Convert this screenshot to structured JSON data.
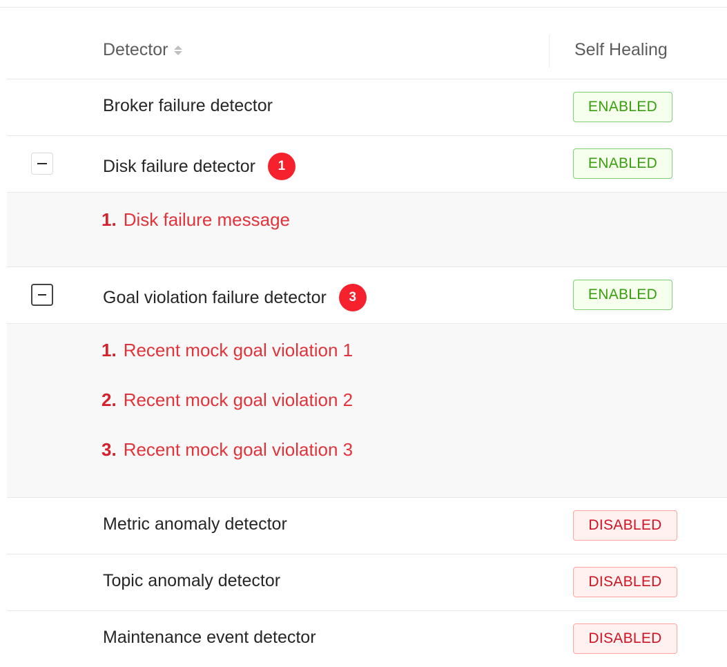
{
  "table": {
    "columns": {
      "detector": "Detector",
      "self_healing": "Self Healing"
    },
    "rows": [
      {
        "name": "Broker failure detector",
        "status": "ENABLED"
      },
      {
        "name": "Disk failure detector",
        "count": "1",
        "status": "ENABLED",
        "messages": [
          {
            "num": "1.",
            "text": "Disk failure message"
          }
        ]
      },
      {
        "name": "Goal violation failure detector",
        "count": "3",
        "status": "ENABLED",
        "messages": [
          {
            "num": "1.",
            "text": "Recent mock goal violation 1"
          },
          {
            "num": "2.",
            "text": "Recent mock goal violation 2"
          },
          {
            "num": "3.",
            "text": "Recent mock goal violation 3"
          }
        ]
      },
      {
        "name": "Metric anomaly detector",
        "status": "DISABLED"
      },
      {
        "name": "Topic anomaly detector",
        "status": "DISABLED"
      },
      {
        "name": "Maintenance event detector",
        "status": "DISABLED"
      }
    ]
  },
  "icons": {
    "sort": "sort-icon",
    "collapse": "minus-square-icon"
  },
  "colors": {
    "enabled_text": "#389e0d",
    "enabled_bg": "#f6ffed",
    "disabled_text": "#cf1322",
    "disabled_bg": "#fff1f0",
    "badge": "#f5222d",
    "message": "#e0343c"
  }
}
